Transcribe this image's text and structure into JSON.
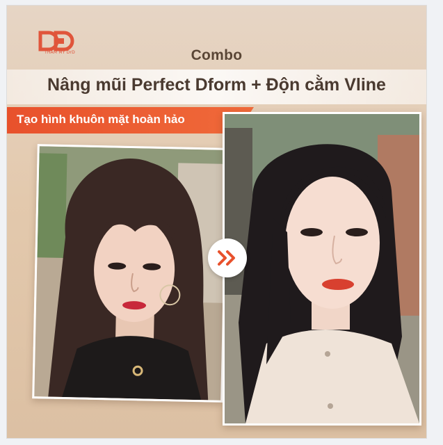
{
  "brand": {
    "logo_text": "DrD",
    "logo_sub": "THẨM MỸ DrD",
    "accent": "#e8512c"
  },
  "header": {
    "combo": "Combo",
    "title": "Nâng mũi Perfect Dform + Độn cằm Vline"
  },
  "ribbon": {
    "text": "Tạo hình khuôn mặt hoàn hảo"
  },
  "photos": {
    "before": "before-photo",
    "after": "after-photo",
    "transition_icon": "double-chevron-right-icon"
  }
}
